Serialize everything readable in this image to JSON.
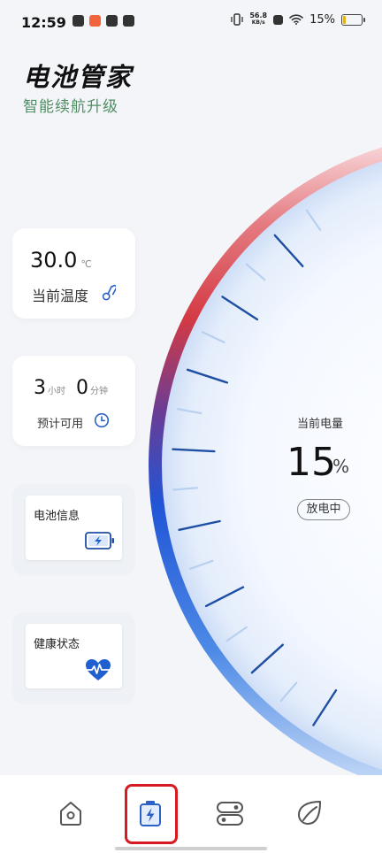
{
  "status_bar": {
    "time": "12:59",
    "net_speed_value": "56.8",
    "net_speed_unit": "KB/s",
    "battery_percent": "15%"
  },
  "app": {
    "title": "电池管家",
    "subtitle": "智能续航升级"
  },
  "temperature": {
    "value": "30.0",
    "unit": "℃",
    "label": "当前温度",
    "icon": "thermometer-icon"
  },
  "remaining": {
    "hours": "3",
    "hours_unit": "小时",
    "minutes": "0",
    "minutes_unit": "分钟",
    "label": "预计可用",
    "icon": "clock-icon"
  },
  "battery_info": {
    "label": "电池信息",
    "icon": "battery-charging-icon"
  },
  "health": {
    "label": "健康状态",
    "icon": "heart-pulse-icon"
  },
  "gauge": {
    "label": "当前电量",
    "value": "15",
    "unit": "%",
    "status": "放电中",
    "level": 0.15
  },
  "nav": {
    "items": [
      {
        "name": "home",
        "icon": "home-icon"
      },
      {
        "name": "battery",
        "icon": "battery-bolt-icon",
        "selected": true
      },
      {
        "name": "toggles",
        "icon": "toggle-icon"
      },
      {
        "name": "leaf",
        "icon": "leaf-icon"
      }
    ]
  },
  "colors": {
    "accent_green": "#4f8f62",
    "gauge_blue": "#1e5fd8",
    "gauge_red": "#d43a44",
    "tick_dark": "#1f4fa3",
    "tick_light": "#b8d0ef",
    "highlight_red": "#d71920"
  }
}
